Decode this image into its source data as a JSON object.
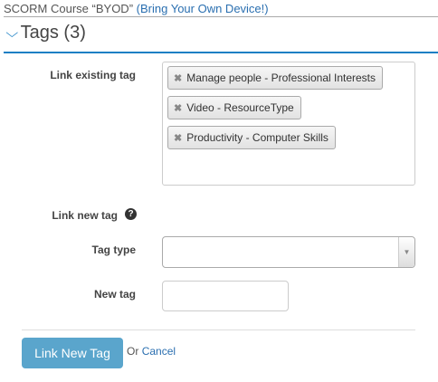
{
  "breadcrumb": {
    "prefix": "SCORM Course “BYOD”",
    "link": "(Bring Your Own Device!)"
  },
  "section": {
    "title": "Tags (3)"
  },
  "form": {
    "link_existing_label": "Link existing tag",
    "tags": [
      "Manage people - Professional Interests",
      "Video - ResourceType",
      "Productivity - Computer Skills"
    ],
    "remove_glyph": "✖",
    "link_new_label": "Link new tag",
    "help_glyph": "?",
    "tag_type_label": "Tag type",
    "tag_type_value": "",
    "new_tag_label": "New tag",
    "new_tag_value": ""
  },
  "actions": {
    "submit": "Link New Tag",
    "or": "Or",
    "cancel": "Cancel"
  }
}
